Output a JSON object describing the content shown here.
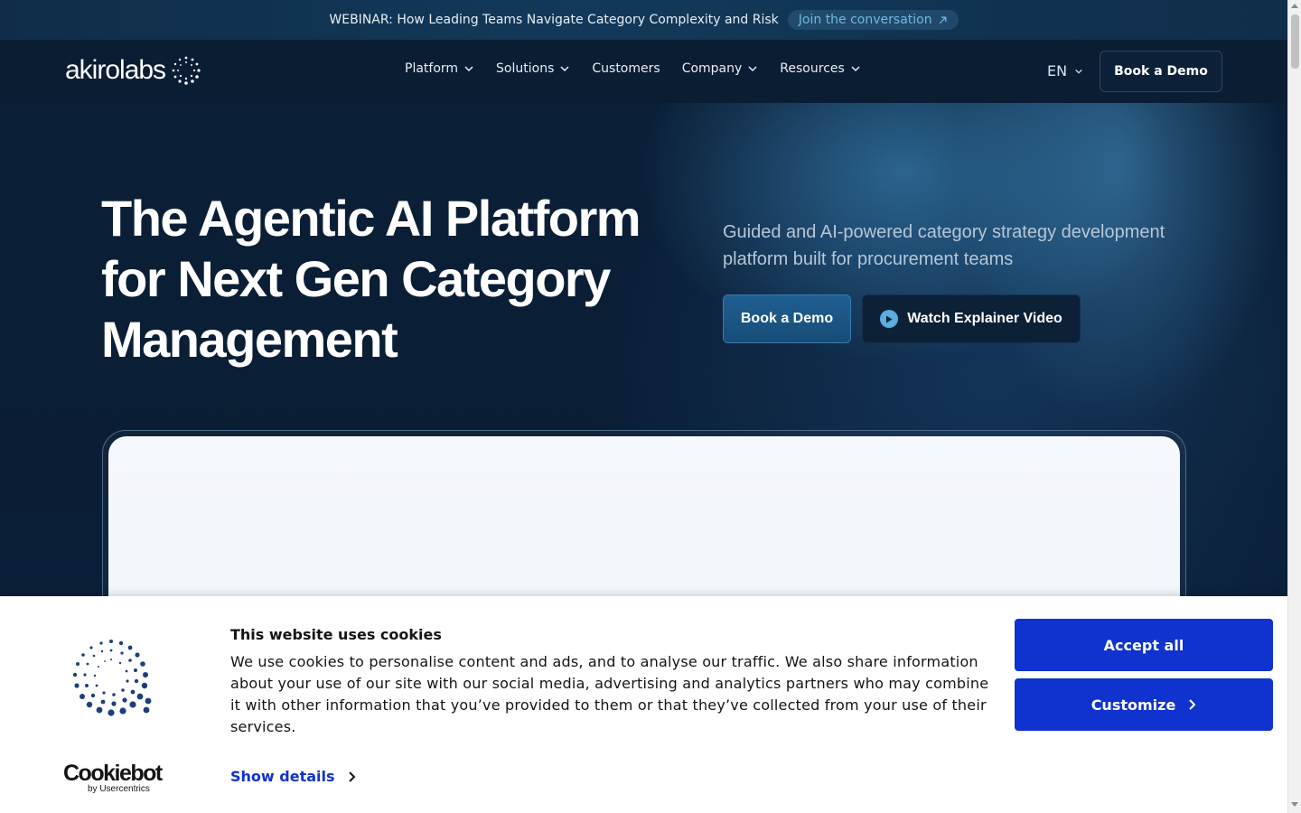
{
  "announcement": {
    "text": "WEBINAR: How Leading Teams Navigate Category Complexity and Risk",
    "link_label": "Join the conversation",
    "link_icon": "arrow-up-right-icon"
  },
  "nav": {
    "logo_text": "akirolabs",
    "items": [
      {
        "label": "Platform",
        "has_dropdown": true
      },
      {
        "label": "Solutions",
        "has_dropdown": true
      },
      {
        "label": "Customers",
        "has_dropdown": false
      },
      {
        "label": "Company",
        "has_dropdown": true
      },
      {
        "label": "Resources",
        "has_dropdown": true
      }
    ],
    "language": "EN",
    "demo_label": "Book a Demo"
  },
  "hero": {
    "title": "The Agentic AI Platform for Next Gen Category Management",
    "subtitle": "Guided and AI-powered category strategy development platform built for procurement teams",
    "primary_button": "Book a Demo",
    "secondary_button": "Watch Explainer Video"
  },
  "cookie": {
    "title": "This website uses cookies",
    "text": "We use cookies to personalise content and ads, and to analyse our traffic. We also share information about your use of our site with our social media, advertising and analytics partners who may combine it with other information that you’ve provided to them or that they’ve collected from your use of their services.",
    "show_details": "Show details",
    "accept_all": "Accept all",
    "customize": "Customize",
    "brand": "Cookiebot",
    "brand_by": "by Usercentrics"
  },
  "colors": {
    "accent_blue": "#1032cf",
    "hero_bg": "#0a1d33",
    "link_cyan": "#6fb7e6"
  }
}
